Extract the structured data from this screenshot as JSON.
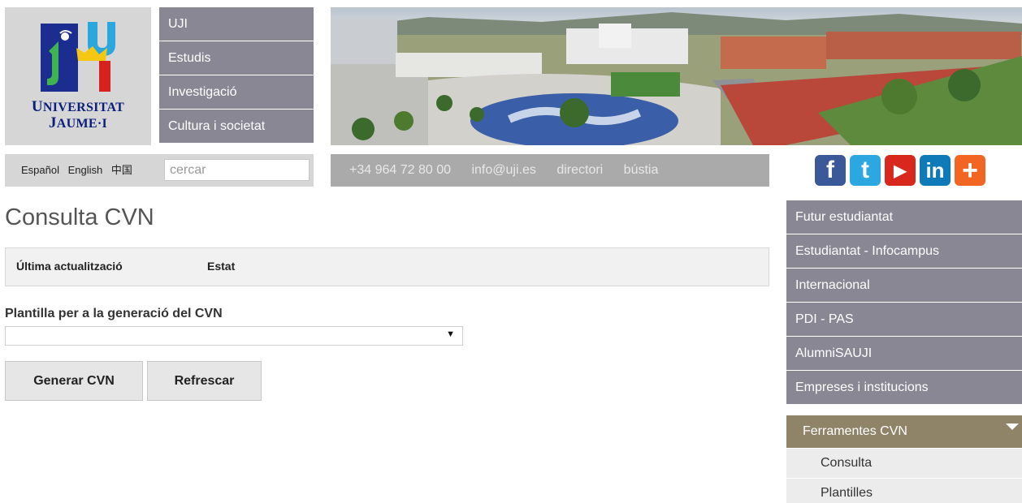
{
  "logo": {
    "line1_big": "U",
    "line1_rest": "NIVERSITAT",
    "line2_big": "J",
    "line2_rest": "AUME·I"
  },
  "topnav": [
    "UJI",
    "Estudis",
    "Investigació",
    "Cultura i societat"
  ],
  "languages": [
    "Español",
    "English",
    "中国"
  ],
  "search": {
    "placeholder": "cercar",
    "value": ""
  },
  "contact": {
    "phone": "+34 964 72 80 00",
    "email": "info@uji.es",
    "directory": "directori",
    "mailbox": "bústia"
  },
  "social": [
    {
      "icon": "facebook-icon",
      "glyph": "f",
      "color": "#3b5998"
    },
    {
      "icon": "twitter-icon",
      "glyph": "t",
      "color": "#2da7e0"
    },
    {
      "icon": "youtube-icon",
      "glyph": "▶",
      "color": "#d8271c"
    },
    {
      "icon": "linkedin-icon",
      "glyph": "in",
      "color": "#0f7ab8"
    },
    {
      "icon": "share-plus-icon",
      "glyph": "+",
      "color": "#f26522"
    }
  ],
  "page": {
    "title": "Consulta CVN",
    "status_headers": [
      "Última actualització",
      "Estat"
    ],
    "template_label": "Plantilla per a la generació del CVN",
    "template_selected": "",
    "generate_button": "Generar CVN",
    "refresh_button": "Refrescar"
  },
  "sidenav": [
    "Futur estudiantat",
    "Estudiantat - Infocampus",
    "Internacional",
    "PDI - PAS",
    "AlumniSAUJI",
    "Empreses i institucions"
  ],
  "tools": {
    "title": "Ferramentes CVN",
    "items": [
      "Consulta",
      "Plantilles"
    ]
  },
  "colors": {
    "nav_bg": "#8a8794",
    "tools_header": "#8f8468",
    "contact_bg": "#aaaaaa",
    "logo_blue": "#0b1f7a"
  }
}
